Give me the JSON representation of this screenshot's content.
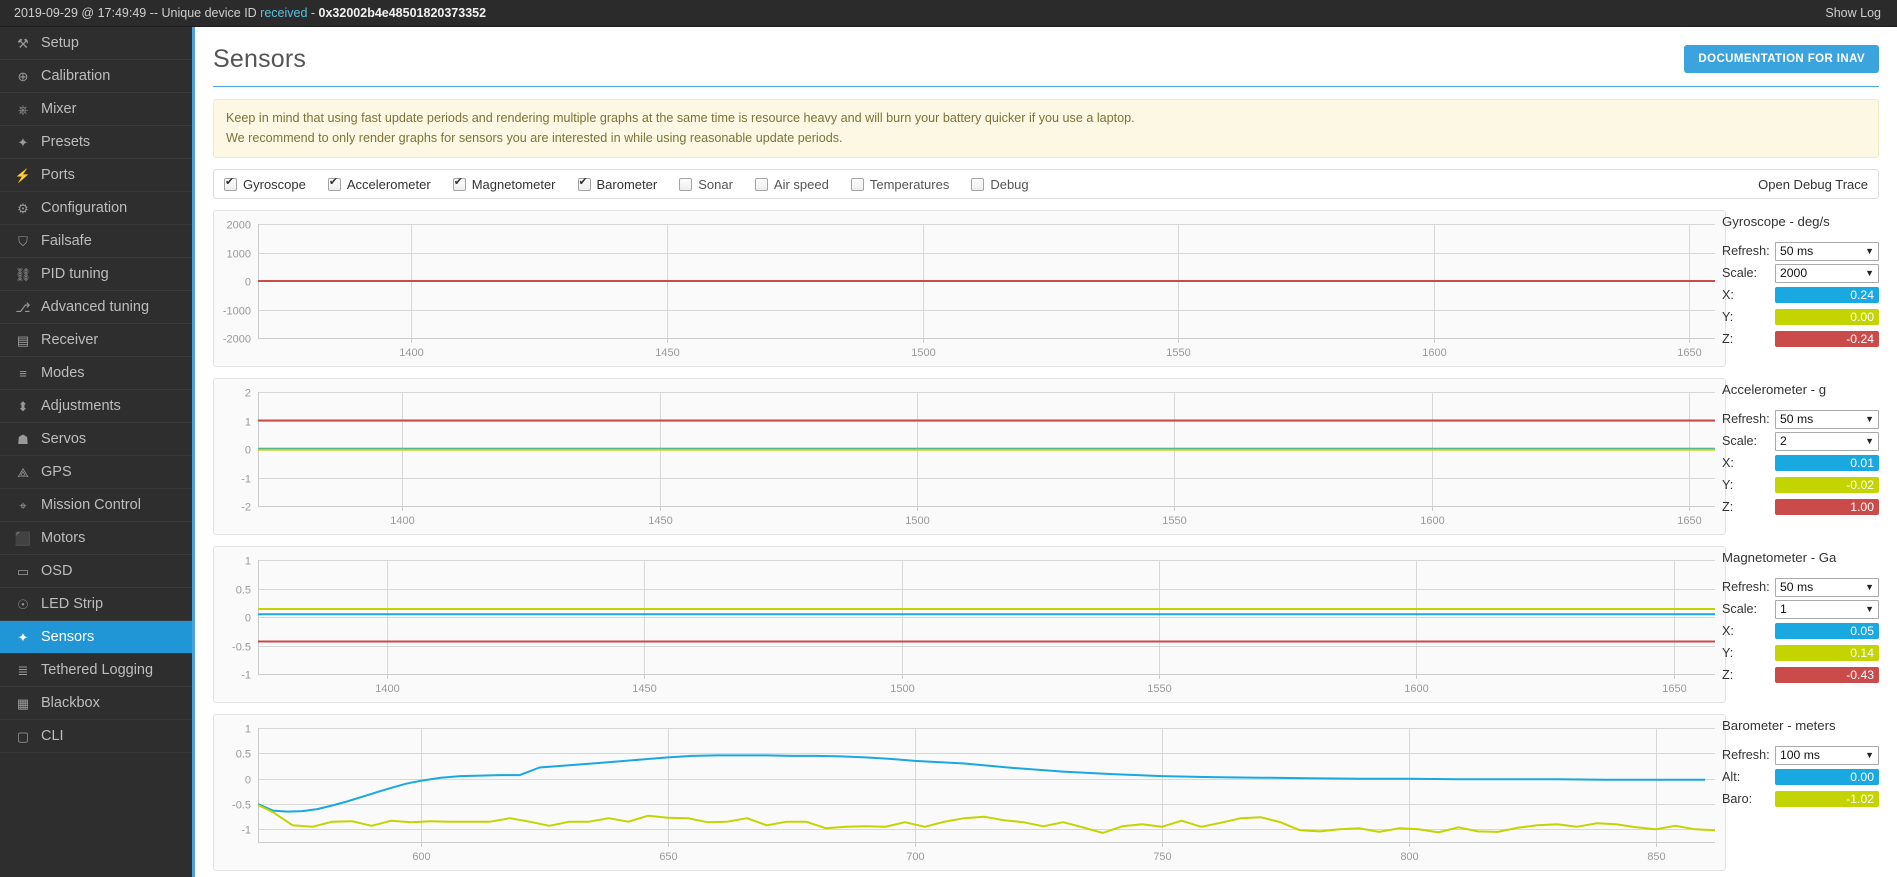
{
  "logbar": {
    "timestamp_text": "2019-09-29 @ 17:49:49 -- Unique device ID ",
    "received_word": "received",
    "dash": " - ",
    "device_id": "0x32002b4e48501820373352",
    "show_log": "Show Log"
  },
  "sidebar": {
    "items": [
      {
        "label": "Setup",
        "icon": "wrench-icon",
        "glyph": "⚒",
        "active": false
      },
      {
        "label": "Calibration",
        "icon": "crosshair-icon",
        "glyph": "⊕",
        "active": false
      },
      {
        "label": "Mixer",
        "icon": "mixer-icon",
        "glyph": "⎈",
        "active": false
      },
      {
        "label": "Presets",
        "icon": "magic-wand-icon",
        "glyph": "✦",
        "active": false
      },
      {
        "label": "Ports",
        "icon": "plug-icon",
        "glyph": "⚡",
        "active": false
      },
      {
        "label": "Configuration",
        "icon": "gear-icon",
        "glyph": "⚙",
        "active": false
      },
      {
        "label": "Failsafe",
        "icon": "parachute-icon",
        "glyph": "⛉",
        "active": false
      },
      {
        "label": "PID tuning",
        "icon": "sitemap-icon",
        "glyph": "⛓",
        "active": false
      },
      {
        "label": "Advanced tuning",
        "icon": "sliders-icon",
        "glyph": "⎇",
        "active": false
      },
      {
        "label": "Receiver",
        "icon": "remote-control-icon",
        "glyph": "▤",
        "active": false
      },
      {
        "label": "Modes",
        "icon": "toggles-icon",
        "glyph": "≡",
        "active": false
      },
      {
        "label": "Adjustments",
        "icon": "faders-icon",
        "glyph": "⬍",
        "active": false
      },
      {
        "label": "Servos",
        "icon": "servo-icon",
        "glyph": "☗",
        "active": false
      },
      {
        "label": "GPS",
        "icon": "satellite-icon",
        "glyph": "⟁",
        "active": false
      },
      {
        "label": "Mission Control",
        "icon": "map-pin-icon",
        "glyph": "⌖",
        "active": false
      },
      {
        "label": "Motors",
        "icon": "motor-icon",
        "glyph": "⬛",
        "active": false
      },
      {
        "label": "OSD",
        "icon": "osd-icon",
        "glyph": "▭",
        "active": false
      },
      {
        "label": "LED Strip",
        "icon": "led-icon",
        "glyph": "☉",
        "active": false
      },
      {
        "label": "Sensors",
        "icon": "sensors-icon",
        "glyph": "✦",
        "active": true
      },
      {
        "label": "Tethered Logging",
        "icon": "log-icon",
        "glyph": "≣",
        "active": false
      },
      {
        "label": "Blackbox",
        "icon": "blackbox-icon",
        "glyph": "▦",
        "active": false
      },
      {
        "label": "CLI",
        "icon": "terminal-icon",
        "glyph": "▢",
        "active": false
      }
    ]
  },
  "page": {
    "title": "Sensors",
    "doc_button": "DOCUMENTATION FOR INAV",
    "notice_line1": "Keep in mind that using fast update periods and rendering multiple graphs at the same time is resource heavy and will burn your battery quicker if you use a laptop.",
    "notice_line2": "We recommend to only render graphs for sensors you are interested in while using reasonable update periods."
  },
  "toolbar": {
    "checkboxes": [
      {
        "label": "Gyroscope",
        "checked": true
      },
      {
        "label": "Accelerometer",
        "checked": true
      },
      {
        "label": "Magnetometer",
        "checked": true
      },
      {
        "label": "Barometer",
        "checked": true
      },
      {
        "label": "Sonar",
        "checked": false
      },
      {
        "label": "Air speed",
        "checked": false
      },
      {
        "label": "Temperatures",
        "checked": false
      },
      {
        "label": "Debug",
        "checked": false
      }
    ],
    "open_debug_trace": "Open Debug Trace"
  },
  "panels": [
    {
      "title": "Gyroscope - deg/s",
      "refresh_label": "Refresh:",
      "refresh_value": "50 ms",
      "scale_label": "Scale:",
      "scale_value": "2000",
      "rows": [
        {
          "label": "X:",
          "value": "0.24",
          "color_class": "v-x"
        },
        {
          "label": "Y:",
          "value": "0.00",
          "color_class": "v-y"
        },
        {
          "label": "Z:",
          "value": "-0.24",
          "color_class": "v-z"
        }
      ]
    },
    {
      "title": "Accelerometer - g",
      "refresh_label": "Refresh:",
      "refresh_value": "50 ms",
      "scale_label": "Scale:",
      "scale_value": "2",
      "rows": [
        {
          "label": "X:",
          "value": "0.01",
          "color_class": "v-x"
        },
        {
          "label": "Y:",
          "value": "-0.02",
          "color_class": "v-y"
        },
        {
          "label": "Z:",
          "value": "1.00",
          "color_class": "v-z"
        }
      ]
    },
    {
      "title": "Magnetometer - Ga",
      "refresh_label": "Refresh:",
      "refresh_value": "50 ms",
      "scale_label": "Scale:",
      "scale_value": "1",
      "rows": [
        {
          "label": "X:",
          "value": "0.05",
          "color_class": "v-x"
        },
        {
          "label": "Y:",
          "value": "0.14",
          "color_class": "v-y"
        },
        {
          "label": "Z:",
          "value": "-0.43",
          "color_class": "v-z"
        }
      ]
    },
    {
      "title": "Barometer - meters",
      "refresh_label": "Refresh:",
      "refresh_value": "100 ms",
      "scale_label": null,
      "scale_value": null,
      "rows": [
        {
          "label": "Alt:",
          "value": "0.00",
          "color_class": "v-x"
        },
        {
          "label": "Baro:",
          "value": "-1.02",
          "color_class": "v-y"
        }
      ]
    }
  ],
  "chart_data": [
    {
      "type": "line",
      "title": "Gyroscope - deg/s",
      "xlabel": "",
      "ylabel": "deg/s",
      "yticks": [
        2000,
        1000,
        0,
        -1000,
        -2000
      ],
      "ylim": [
        -2000,
        2000
      ],
      "xticks": [
        1400,
        1450,
        1500,
        1550,
        1600,
        1650
      ],
      "xlim": [
        1370,
        1655
      ],
      "grid": true,
      "legend_position": "right",
      "series": [
        {
          "name": "X",
          "color": "#19a8e0",
          "constant": 0.24
        },
        {
          "name": "Y",
          "color": "#c3d400",
          "constant": 0.0
        },
        {
          "name": "Z",
          "color": "#cb4b4b",
          "constant": -0.24
        }
      ]
    },
    {
      "type": "line",
      "title": "Accelerometer - g",
      "xlabel": "",
      "ylabel": "g",
      "yticks": [
        2,
        1,
        0,
        -1,
        -2
      ],
      "ylim": [
        -2,
        2
      ],
      "xticks": [
        1400,
        1450,
        1500,
        1550,
        1600,
        1650
      ],
      "xlim": [
        1372,
        1655
      ],
      "grid": true,
      "legend_position": "right",
      "series": [
        {
          "name": "X",
          "color": "#19a8e0",
          "constant": 0.01
        },
        {
          "name": "Y",
          "color": "#c3d400",
          "constant": -0.02
        },
        {
          "name": "Z",
          "color": "#cb4b4b",
          "constant": 1.0
        }
      ]
    },
    {
      "type": "line",
      "title": "Magnetometer - Ga",
      "xlabel": "",
      "ylabel": "Ga",
      "yticks": [
        1,
        0.5,
        0,
        -0.5,
        -1
      ],
      "ylim": [
        -1,
        1
      ],
      "xticks": [
        1400,
        1450,
        1500,
        1550,
        1600,
        1650
      ],
      "xlim": [
        1375,
        1658
      ],
      "grid": true,
      "legend_position": "right",
      "series": [
        {
          "name": "X",
          "color": "#19a8e0",
          "constant": 0.05
        },
        {
          "name": "Y",
          "color": "#c3d400",
          "constant": 0.14
        },
        {
          "name": "Z",
          "color": "#cb4b4b",
          "constant": -0.43
        }
      ]
    },
    {
      "type": "line",
      "title": "Barometer - meters",
      "xlabel": "",
      "ylabel": "meters",
      "yticks": [
        1,
        0.5,
        0,
        -0.5,
        -1
      ],
      "ylim": [
        -1.25,
        1
      ],
      "xticks": [
        600,
        650,
        700,
        750,
        800,
        850
      ],
      "xlim": [
        567,
        862
      ],
      "grid": true,
      "legend_position": "right",
      "series": [
        {
          "name": "Alt",
          "color": "#19a8e0",
          "x": [
            567,
            570,
            573,
            576,
            579,
            582,
            585,
            588,
            591,
            594,
            597,
            600,
            604,
            608,
            612,
            616,
            620,
            624,
            628,
            632,
            636,
            640,
            645,
            650,
            655,
            660,
            665,
            670,
            675,
            680,
            685,
            690,
            695,
            700,
            710,
            720,
            730,
            740,
            750,
            760,
            770,
            780,
            790,
            800,
            810,
            820,
            830,
            840,
            850,
            860
          ],
          "y": [
            -0.5,
            -0.63,
            -0.65,
            -0.64,
            -0.6,
            -0.53,
            -0.45,
            -0.36,
            -0.27,
            -0.18,
            -0.1,
            -0.04,
            0.02,
            0.05,
            0.06,
            0.07,
            0.07,
            0.22,
            0.25,
            0.28,
            0.31,
            0.34,
            0.38,
            0.42,
            0.45,
            0.46,
            0.46,
            0.46,
            0.45,
            0.45,
            0.44,
            0.42,
            0.39,
            0.35,
            0.3,
            0.21,
            0.14,
            0.09,
            0.05,
            0.03,
            0.02,
            0.01,
            0.0,
            0.0,
            -0.01,
            -0.01,
            -0.01,
            -0.02,
            -0.02,
            -0.02
          ]
        },
        {
          "name": "Baro",
          "color": "#c3d400",
          "x": [
            567,
            570,
            574,
            578,
            582,
            586,
            590,
            594,
            598,
            602,
            606,
            610,
            614,
            618,
            622,
            626,
            630,
            634,
            638,
            642,
            646,
            650,
            654,
            658,
            662,
            666,
            670,
            674,
            678,
            682,
            686,
            690,
            694,
            698,
            702,
            706,
            710,
            714,
            718,
            722,
            726,
            730,
            734,
            738,
            742,
            746,
            750,
            754,
            758,
            762,
            766,
            770,
            774,
            778,
            782,
            786,
            790,
            794,
            798,
            802,
            806,
            810,
            814,
            818,
            822,
            826,
            830,
            834,
            838,
            842,
            846,
            850,
            854,
            858,
            862
          ],
          "y": [
            -0.52,
            -0.66,
            -0.92,
            -0.95,
            -0.85,
            -0.84,
            -0.93,
            -0.83,
            -0.86,
            -0.84,
            -0.85,
            -0.85,
            -0.85,
            -0.78,
            -0.85,
            -0.93,
            -0.85,
            -0.85,
            -0.78,
            -0.85,
            -0.73,
            -0.77,
            -0.78,
            -0.86,
            -0.85,
            -0.78,
            -0.92,
            -0.85,
            -0.85,
            -0.98,
            -0.95,
            -0.94,
            -0.95,
            -0.86,
            -0.95,
            -0.85,
            -0.78,
            -0.75,
            -0.82,
            -0.86,
            -0.94,
            -0.86,
            -0.96,
            -1.07,
            -0.94,
            -0.9,
            -0.95,
            -0.83,
            -0.95,
            -0.87,
            -0.78,
            -0.76,
            -0.86,
            -1.02,
            -1.04,
            -1.0,
            -0.98,
            -1.05,
            -0.98,
            -1.0,
            -1.06,
            -0.96,
            -1.04,
            -1.05,
            -0.97,
            -0.92,
            -0.9,
            -0.95,
            -0.88,
            -0.9,
            -0.96,
            -1.0,
            -0.93,
            -1.0,
            -1.02
          ]
        }
      ]
    }
  ]
}
